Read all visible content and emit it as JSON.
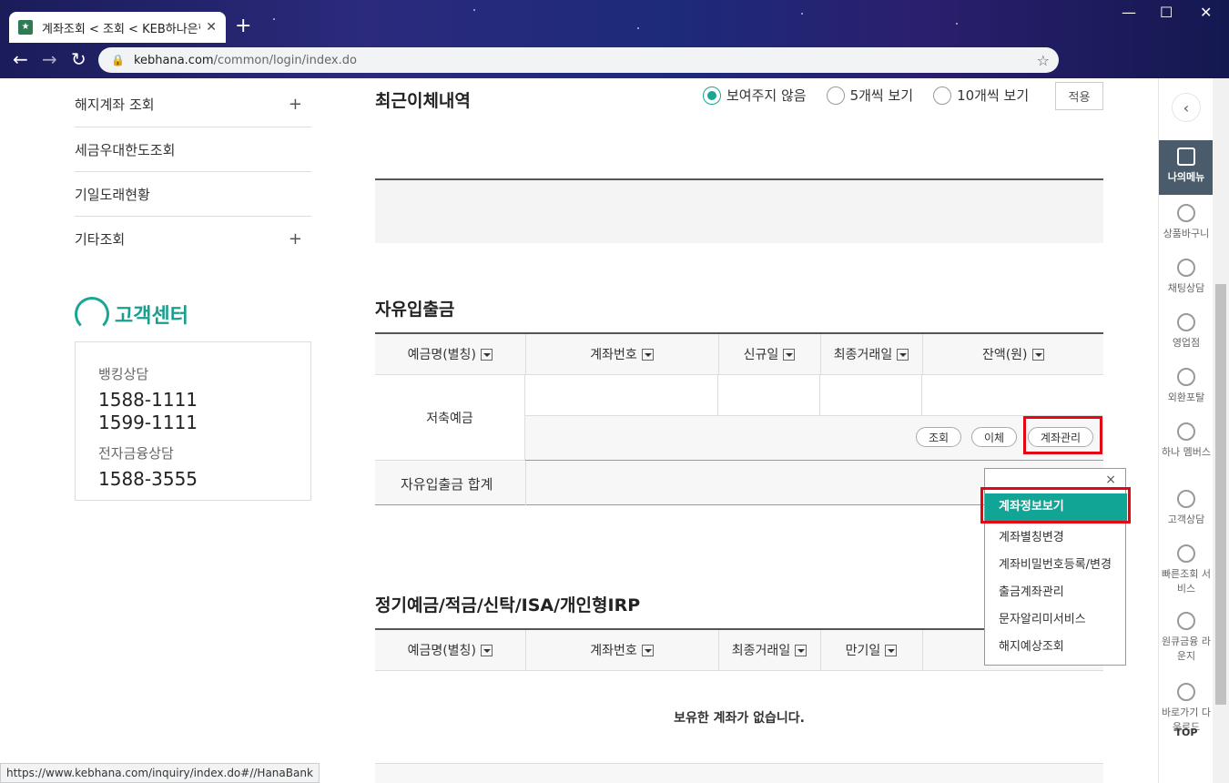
{
  "browser": {
    "tab_title": "계좌조회 < 조회 < KEB하나은행",
    "url_domain": "kebhana.com",
    "url_path": "/common/login/index.do",
    "status_url": "https://www.kebhana.com/inquiry/index.do#//HanaBank"
  },
  "leftnav": {
    "items": [
      {
        "label": "해지계좌 조회",
        "plus": "+"
      },
      {
        "label": "세금우대한도조회",
        "plus": ""
      },
      {
        "label": "기일도래현황",
        "plus": ""
      },
      {
        "label": "기타조회",
        "plus": "+"
      }
    ]
  },
  "customer_center": {
    "title": "고객센터",
    "banking_label": "뱅킹상담",
    "banking_num1": "1588-1111",
    "banking_num2": "1599-1111",
    "efin_label": "전자금융상담",
    "efin_num": "1588-3555"
  },
  "recent": {
    "title": "최근이체내역",
    "opt_hide": "보여주지 않음",
    "opt_5": "5개씩 보기",
    "opt_10": "10개씩 보기",
    "apply": "적용"
  },
  "free": {
    "title": "자유입출금",
    "headers": [
      "예금명(별칭)",
      "계좌번호",
      "신규일",
      "최종거래일",
      "잔액(원)"
    ],
    "account_name": "저축예금",
    "btn_inquiry": "조회",
    "btn_transfer": "이체",
    "btn_manage": "계좌관리",
    "sum_label": "자유입출금 합계"
  },
  "dropdown": {
    "close": "×",
    "items": [
      "계좌정보보기",
      "계좌별칭변경",
      "계좌비밀번호등록/변경",
      "출금계좌관리",
      "문자알리미서비스",
      "해지예상조회"
    ]
  },
  "deposit": {
    "title": "정기예금/적금/신탁/ISA/개인형IRP",
    "headers": [
      "예금명(별칭)",
      "계좌번호",
      "최종거래일",
      "만기일"
    ],
    "empty": "보유한 계좌가 없습니다."
  },
  "quickbar": {
    "items": [
      "나의메뉴",
      "상품바구니",
      "채팅상담",
      "영업점",
      "외환포탈",
      "하나 멤버스",
      "고객상담",
      "빠른조회 서비스",
      "원큐금융 라운지",
      "바로가기 다운로드"
    ],
    "top": "TOP"
  }
}
